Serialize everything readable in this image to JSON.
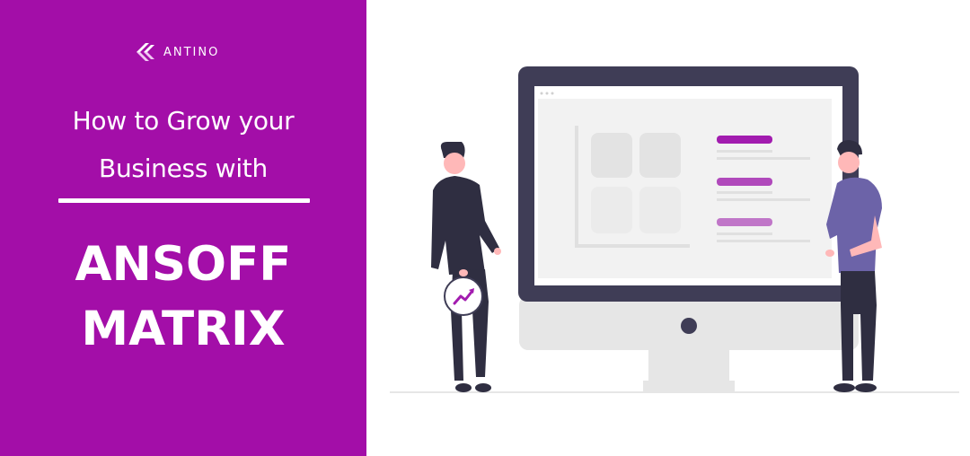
{
  "brand": {
    "name": "ANTINO"
  },
  "title": {
    "line1": "How to Grow your",
    "line2": "Business with",
    "headline_line1": "ANSOFF",
    "headline_line2": "MATRIX"
  },
  "colors": {
    "panel": "#a30ea8",
    "accent": "#a21caf",
    "monitor_frame": "#3f3d56",
    "screen": "#f2f2f2",
    "text": "#ffffff"
  },
  "icons": [
    "antino-logo-icon",
    "trend-up-icon"
  ]
}
